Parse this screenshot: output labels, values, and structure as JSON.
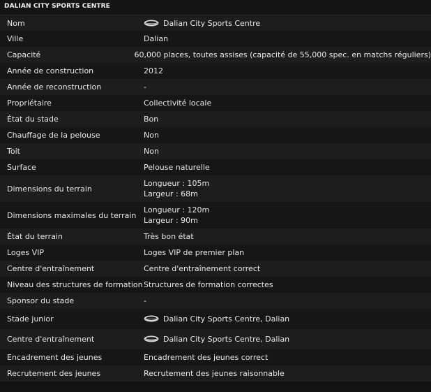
{
  "title": "DALIAN CITY SPORTS CENTRE",
  "rows": [
    {
      "label": "Nom",
      "value": "Dalian City Sports Centre",
      "icon": "stadium-icon"
    },
    {
      "label": "Ville",
      "value": "Dalian"
    },
    {
      "label": "Capacité",
      "value": "60,000 places, toutes assises (capacité de 55,000 spec. en matchs réguliers)"
    },
    {
      "label": "Année de construction",
      "value": "2012"
    },
    {
      "label": "Année de reconstruction",
      "value": "-"
    },
    {
      "label": "Propriétaire",
      "value": "Collectivité locale"
    },
    {
      "label": "État du stade",
      "value": "Bon"
    },
    {
      "label": "Chauffage de la pelouse",
      "value": "Non"
    },
    {
      "label": "Toit",
      "value": "Non"
    },
    {
      "label": "Surface",
      "value": "Pelouse naturelle"
    },
    {
      "label": "Dimensions du terrain",
      "value1": "Longueur : 105m",
      "value2": "Largeur : 68m"
    },
    {
      "label": "Dimensions maximales du terrain",
      "value1": "Longueur : 120m",
      "value2": "Largeur : 90m"
    },
    {
      "label": "État du terrain",
      "value": "Très bon état"
    },
    {
      "label": "Loges VIP",
      "value": "Loges VIP de premier plan"
    },
    {
      "label": "Centre d'entraînement",
      "value": "Centre d'entraînement correct"
    },
    {
      "label": "Niveau des structures de formation",
      "value": "Structures de formation correctes"
    },
    {
      "label": "Sponsor du stade",
      "value": "-"
    },
    {
      "label": "Stade junior",
      "value": "Dalian City Sports Centre, Dalian",
      "icon": "stadium-icon"
    },
    {
      "label": "Centre d'entraînement",
      "value": "Dalian City Sports Centre, Dalian",
      "icon": "stadium-icon"
    },
    {
      "label": "Encadrement des jeunes",
      "value": "Encadrement des jeunes correct"
    },
    {
      "label": "Recrutement des jeunes",
      "value": "Recrutement des jeunes raisonnable"
    }
  ]
}
